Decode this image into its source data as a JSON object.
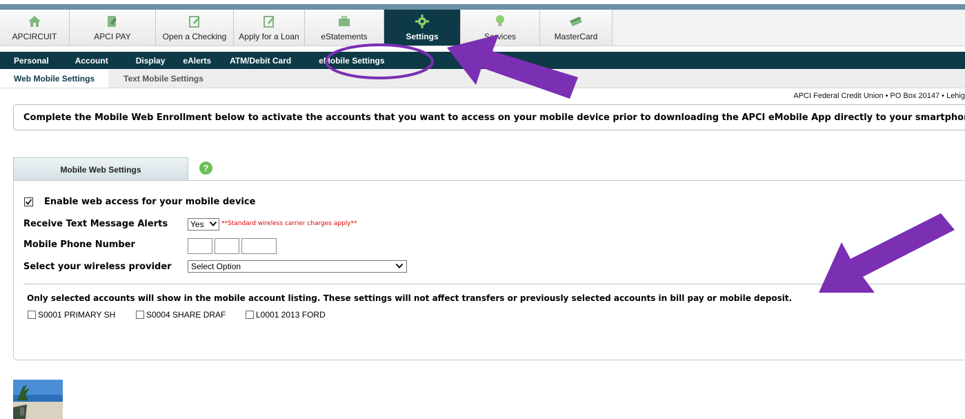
{
  "colors": {
    "nav_dark": "#0e3a48",
    "annotation": "#7b2fb3",
    "warning_red": "#e00000",
    "help_green": "#6bbf59"
  },
  "top_tabs": [
    {
      "label": "APCIRCUIT",
      "icon": "home-icon"
    },
    {
      "label": "APCI PAY",
      "icon": "bill-pay-icon"
    },
    {
      "label": "Open a Checking",
      "icon": "edit-document-icon"
    },
    {
      "label": "Apply for a Loan",
      "icon": "edit-document-icon"
    },
    {
      "label": "eStatements",
      "icon": "briefcase-icon"
    },
    {
      "label": "Settings",
      "icon": "gear-icon"
    },
    {
      "label": "Services",
      "icon": "lightbulb-icon"
    },
    {
      "label": "MasterCard",
      "icon": "card-icon"
    }
  ],
  "sub_nav": [
    "Personal",
    "Account",
    "Display",
    "eAlerts",
    "ATM/Debit Card",
    "eMobile Settings"
  ],
  "sub_sub_nav": [
    "Web Mobile Settings",
    "Text Mobile Settings"
  ],
  "address": "APCI Federal Credit Union • PO Box 20147 • Lehig",
  "notice": "Complete the Mobile Web Enrollment below to activate the accounts that you want to access on your mobile device prior to downloading the APCI eMobile App directly to your smartphone or tablet.",
  "panel_tab": "Mobile Web Settings",
  "help_icon": "?",
  "form": {
    "enable_label": "Enable web access for your mobile device",
    "text_alerts_label": "Receive Text Message Alerts",
    "text_alerts_value": "Yes",
    "charges_warning": "**Standard wireless carrier charges apply**",
    "phone_label": "Mobile Phone Number",
    "provider_label": "Select your wireless provider",
    "provider_value": "Select Option"
  },
  "accounts_notice": "Only selected accounts will show in the mobile account listing.  These settings will not affect transfers or previously selected accounts in bill pay or mobile deposit.",
  "accounts": [
    "S0001 PRIMARY SH",
    "S0004 SHARE DRAF",
    "L0001 2013 FORD"
  ]
}
